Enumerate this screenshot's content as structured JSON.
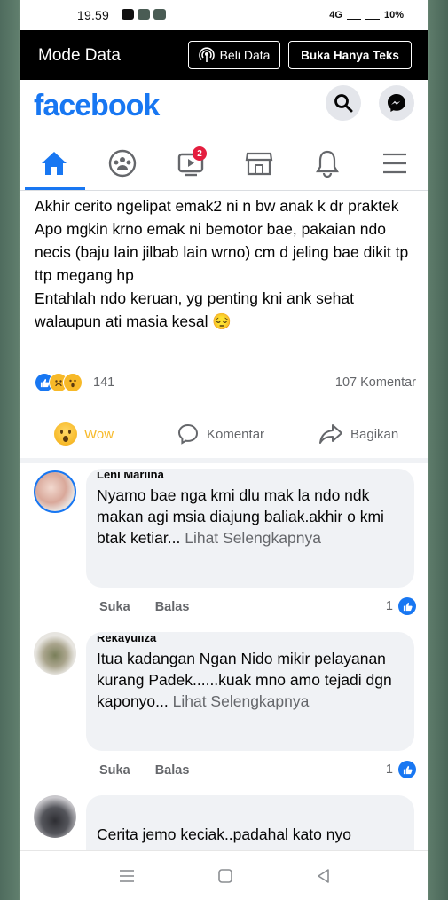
{
  "status": {
    "time": "19.59",
    "network": "4G",
    "battery": "10%"
  },
  "mode_bar": {
    "title": "Mode Data",
    "beli_label": "Beli Data",
    "teks_label": "Buka Hanya Teks"
  },
  "header": {
    "logo": "facebook"
  },
  "nav": {
    "watch_badge": "2"
  },
  "post": {
    "lines": [
      "Akhir cerito ngelipat emak2 ni n bw anak k dr praktek",
      "Apo mgkin krno emak ni bemotor bae, pakaian ndo necis (baju lain jilbab lain wrno) cm d jeling bae dikit tp ttp megang hp",
      "Entahlah ndo keruan, yg penting kni ank sehat walaupun ati masia kesal 😔"
    ],
    "reaction_count": "141",
    "comment_count": "107 Komentar",
    "actions": {
      "wow": "Wow",
      "comment": "Komentar",
      "share": "Bagikan"
    }
  },
  "comments": [
    {
      "name": "Leni Marlina",
      "text": "Nyamo bae nga kmi dlu mak la ndo ndk makan agi msia diajung baliak.akhir o kmi btak ketiar... ",
      "see_more": "Lihat Selengkapnya",
      "like": "Suka",
      "reply": "Balas",
      "likes": "1"
    },
    {
      "name": "Rekayuliza",
      "text": "Itua kadangan Ngan Nido mikir pelayanan kurang Padek......kuak mno amo tejadi dgn kaponyo... ",
      "see_more": "Lihat Selengkapnya",
      "like": "Suka",
      "reply": "Balas",
      "likes": "1"
    },
    {
      "name": "",
      "text": "Cerita jemo keciak..padahal kato nyo"
    }
  ],
  "colors": {
    "fb_blue": "#1877f2",
    "wow": "#f7b928",
    "bubble": "#f0f2f5"
  }
}
